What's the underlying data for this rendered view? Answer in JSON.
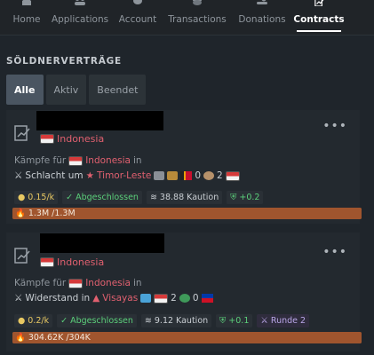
{
  "nav": {
    "items": [
      {
        "label": "Home",
        "icon": "home-icon"
      },
      {
        "label": "Applications",
        "icon": "people-icon"
      },
      {
        "label": "Account",
        "icon": "piggy-bank-icon"
      },
      {
        "label": "Transactions",
        "icon": "coins-icon"
      },
      {
        "label": "Donations",
        "icon": "hand-coins-icon"
      },
      {
        "label": "Contracts",
        "icon": "contract-icon"
      }
    ],
    "active": "Contracts"
  },
  "section_title": "SÖLDNERVERTRÄGE",
  "filters": [
    "Alle",
    "Aktiv",
    "Beendet"
  ],
  "active_filter": "Alle",
  "contracts": [
    {
      "country": "Indonesia",
      "fight_for_label": "Kämpfe für",
      "fight_for_country": "Indonesia",
      "in_label": "in",
      "battle_type": "Schlacht um",
      "battle_region": "Timor-Leste",
      "count_a": "0",
      "count_b": "2",
      "rate": "0.15/k",
      "status": "Abgeschlossen",
      "deposit": "38.88 Kaution",
      "bonus": "+0.2",
      "round": "",
      "progress_text": "1.3M /1.3M",
      "progress_fraction": 1.0
    },
    {
      "country": "Indonesia",
      "fight_for_label": "Kämpfe für",
      "fight_for_country": "Indonesia",
      "in_label": "in",
      "battle_type": "Widerstand in",
      "battle_region": "Visayas",
      "count_a": "2",
      "count_b": "0",
      "rate": "0.2/k",
      "status": "Abgeschlossen",
      "deposit": "9.12 Kaution",
      "bonus": "+0.1",
      "round": "Runde 2",
      "progress_text": "304.62K /304K",
      "progress_fraction": 1.0
    }
  ],
  "colors": {
    "accent_red": "#e0606f",
    "green": "#5bcf7a",
    "gold": "#e8c862",
    "progress": "#a0552e"
  }
}
